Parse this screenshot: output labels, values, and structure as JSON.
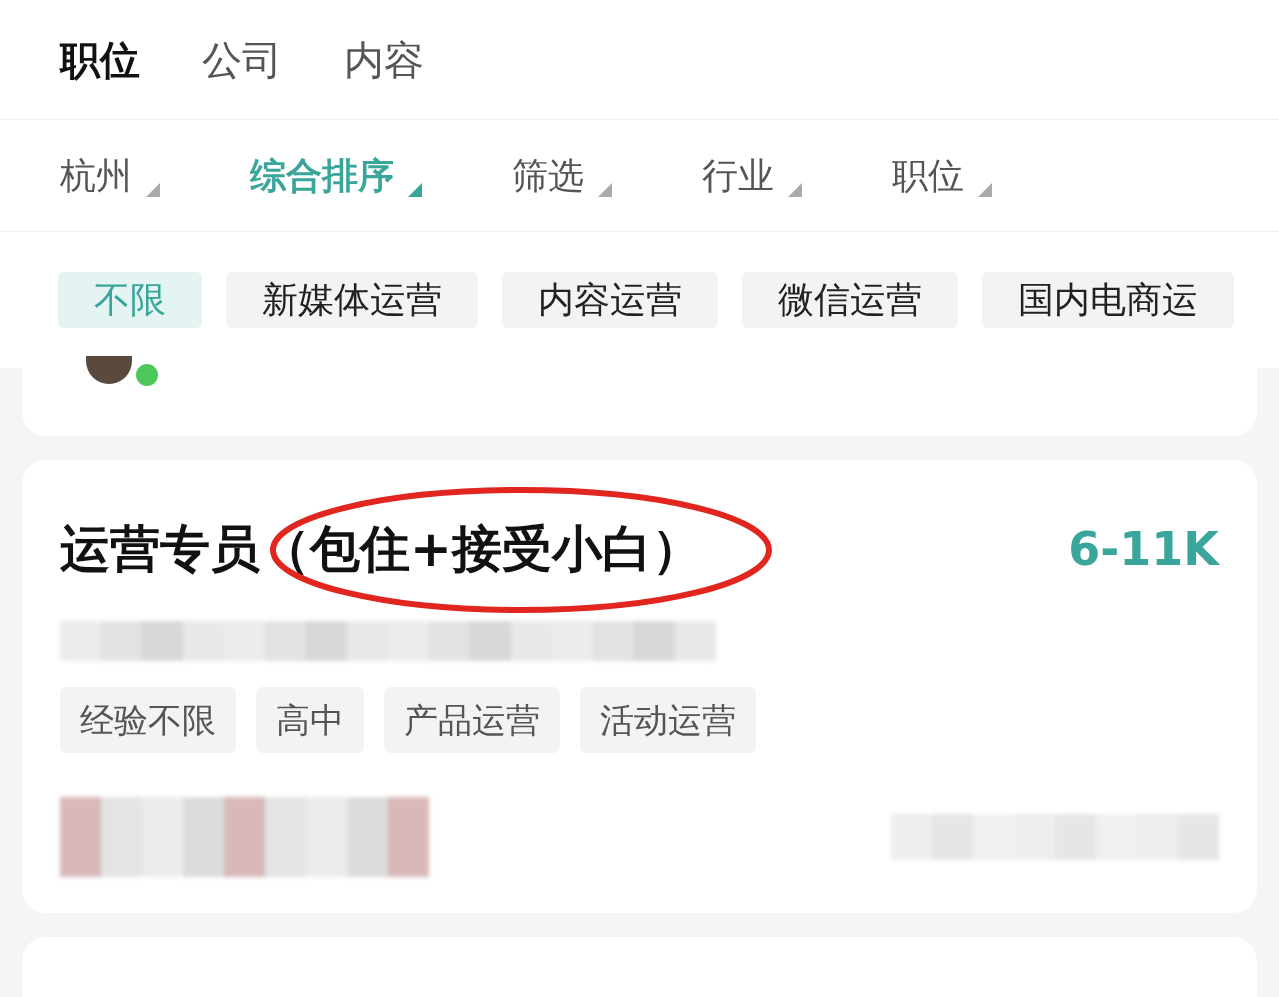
{
  "top_tabs": [
    {
      "label": "职位",
      "selected": true
    },
    {
      "label": "公司",
      "selected": false
    },
    {
      "label": "内容",
      "selected": false
    }
  ],
  "filters": [
    {
      "label": "杭州",
      "selected": false
    },
    {
      "label": "综合排序",
      "selected": true
    },
    {
      "label": "筛选",
      "selected": false
    },
    {
      "label": "行业",
      "selected": false
    },
    {
      "label": "职位",
      "selected": false
    }
  ],
  "chips": [
    {
      "label": "不限",
      "selected": true
    },
    {
      "label": "新媒体运营",
      "selected": false
    },
    {
      "label": "内容运营",
      "selected": false
    },
    {
      "label": "微信运营",
      "selected": false
    },
    {
      "label": "国内电商运",
      "selected": false
    }
  ],
  "partial_card": {
    "online": true
  },
  "job_card": {
    "title": "运营专员",
    "highlight": "（包住+接受小白）",
    "annotated": true,
    "salary": "6-11K",
    "tags": [
      "经验不限",
      "高中",
      "产品运营",
      "活动运营"
    ]
  }
}
